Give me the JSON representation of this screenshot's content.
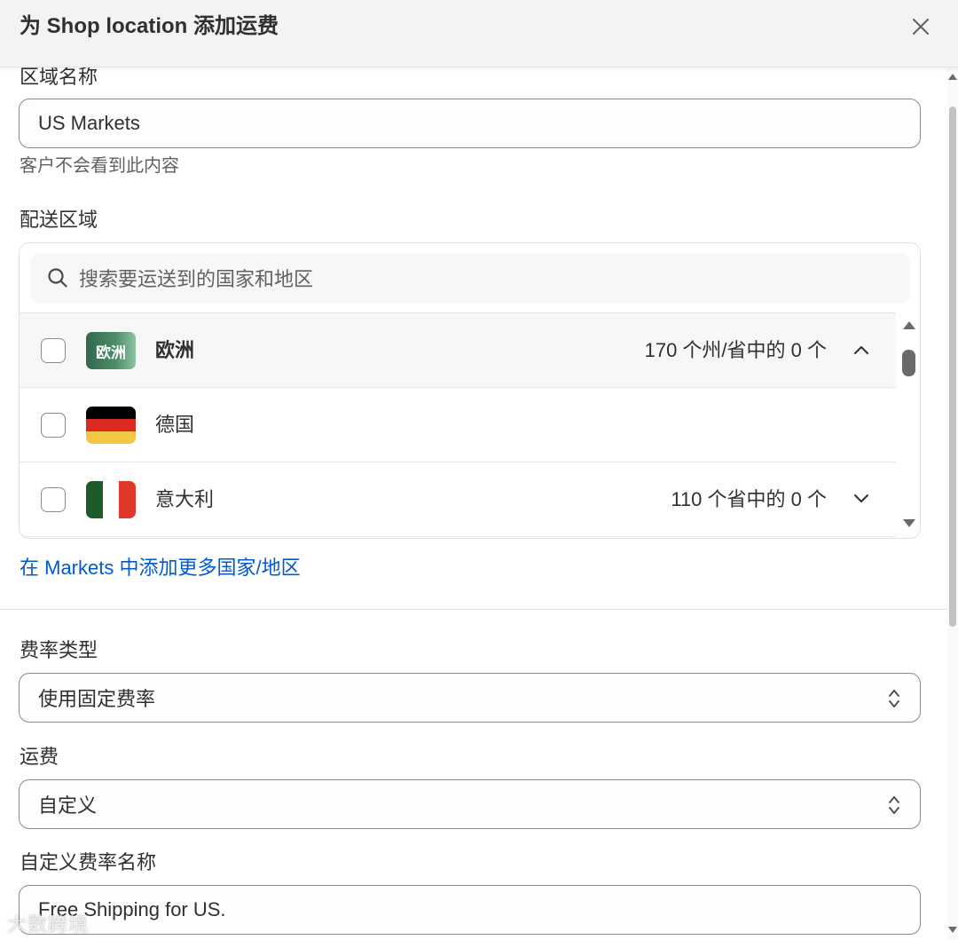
{
  "header": {
    "title": "为 Shop location 添加运费"
  },
  "zone_name": {
    "label": "区域名称",
    "value": "US Markets",
    "help": "客户不会看到此内容"
  },
  "shipping_zone": {
    "label": "配送区域",
    "search_placeholder": "搜索要运送到的国家和地区",
    "rows": [
      {
        "name": "欧洲",
        "badge": "欧洲",
        "count": "170 个州/省中的 0 个",
        "expanded": true
      },
      {
        "name": "德国",
        "count": ""
      },
      {
        "name": "意大利",
        "count": "110 个省中的 0 个",
        "expanded": false
      }
    ]
  },
  "add_more_link": "在 Markets 中添加更多国家/地区",
  "rate_type": {
    "label": "费率类型",
    "value": "使用固定费率"
  },
  "shipping_fee": {
    "label": "运费",
    "value": "自定义"
  },
  "custom_rate_name": {
    "label": "自定义费率名称",
    "value": "Free Shipping for US."
  },
  "watermark": "大数跨境",
  "colors": {
    "link": "#005bd3",
    "europe_badge": "#3f7a5a",
    "border": "#8a8a8a"
  }
}
